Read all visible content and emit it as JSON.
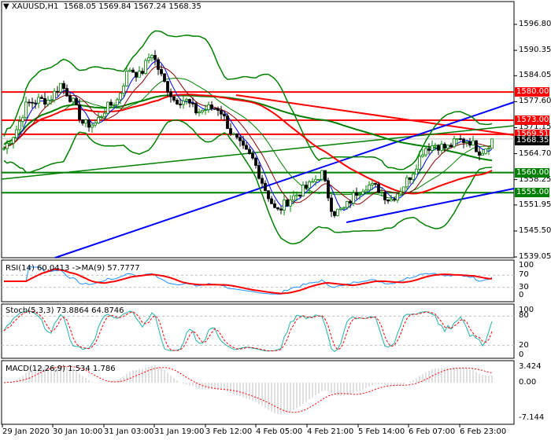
{
  "header": {
    "symbol": "XAUUSD,H1",
    "open": "1568.05",
    "high": "1569.84",
    "low": "1567.24",
    "close": "1568.35"
  },
  "price_axis": [
    "1596.80",
    "1590.35",
    "1584.05",
    "1577.60",
    "1571.15",
    "1564.70",
    "1558.25",
    "1551.95",
    "1545.50",
    "1539.05"
  ],
  "levels": [
    {
      "label": "1580.00",
      "price": 1580.0,
      "color": "#ff0000"
    },
    {
      "label": "1573.00",
      "price": 1573.0,
      "color": "#ff0000"
    },
    {
      "label": "1569.51",
      "price": 1569.51,
      "color": "#ff0000"
    },
    {
      "label": "1560.00",
      "price": 1560.0,
      "color": "#008000"
    },
    {
      "label": "1555.00",
      "price": 1555.0,
      "color": "#008000"
    }
  ],
  "current_price": {
    "label": "1568.35",
    "price": 1568.35
  },
  "price_path": [
    1566,
    1570,
    1577,
    1578,
    1578,
    1582,
    1578,
    1572,
    1572,
    1576,
    1578,
    1586,
    1584,
    1590,
    1583,
    1578,
    1578,
    1575,
    1576,
    1576,
    1570,
    1566,
    1563,
    1556,
    1550,
    1553,
    1555,
    1557,
    1560,
    1550,
    1551,
    1555,
    1557,
    1556,
    1553,
    1556,
    1560,
    1566,
    1567,
    1566,
    1568,
    1568,
    1565,
    1568
  ],
  "rsi": {
    "title": "RSI(14) 60.0413  ->MA(9) 57.7777",
    "levels": [
      "100",
      "70",
      "30",
      "0"
    ]
  },
  "stoch": {
    "title": "Stoch(5,3,3) 73.8864 64.8746",
    "levels": [
      "100",
      "80",
      "20",
      "0"
    ]
  },
  "macd": {
    "title": "MACD(12,26,9) 1.534 1.786",
    "levels": [
      "3.424",
      "0.00",
      "-7.144"
    ]
  },
  "time_axis": [
    "29 Jan 2020",
    "30 Jan 10:00",
    "31 Jan 03:00",
    "31 Jan 19:00",
    "3 Feb 12:00",
    "4 Feb 05:00",
    "4 Feb 21:00",
    "5 Feb 14:00",
    "6 Feb 07:00",
    "6 Feb 23:00"
  ],
  "colors": {
    "bull": "#008000",
    "bear": "#000000",
    "bands": "#008000",
    "channel": "#0000ff",
    "trend": "#ff0000"
  }
}
